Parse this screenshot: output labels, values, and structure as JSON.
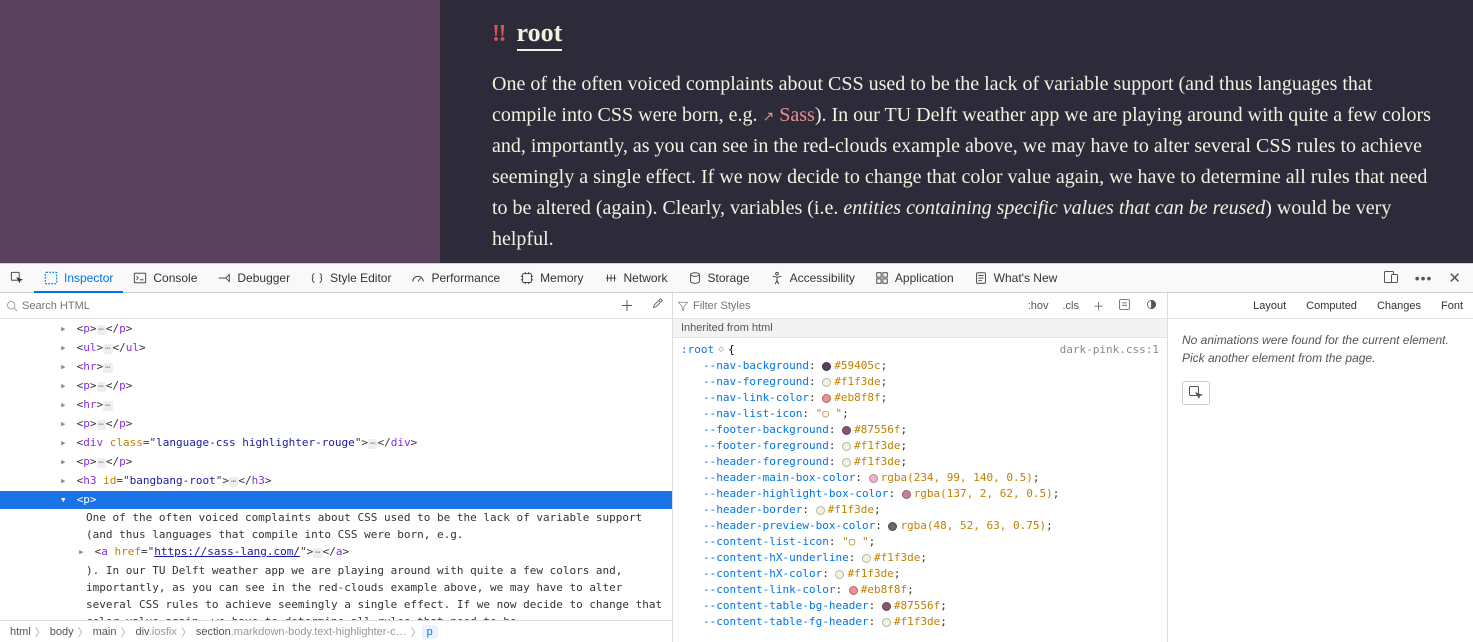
{
  "page": {
    "heading_icon": "‼",
    "heading_text": "root",
    "body_before_link": "One of the often voiced complaints about CSS used to be the lack of variable support (and thus languages that compile into CSS were born, e.g. ",
    "arrow": "↗",
    "link_text": "Sass",
    "body_mid": "). In our TU Delft weather app we are playing around with quite a few colors and, importantly, as you can see in the red-clouds example above, we may have to alter several CSS rules to achieve seemingly a single effect. If we now decide to change that color value again, we have to determine all rules that need to be altered (again). Clearly, variables (i.e. ",
    "body_italic": "entities containing specific values that can be reused",
    "body_after": ") would be very helpful."
  },
  "tabs": {
    "inspector": "Inspector",
    "console": "Console",
    "debugger": "Debugger",
    "styleeditor": "Style Editor",
    "performance": "Performance",
    "memory": "Memory",
    "network": "Network",
    "storage": "Storage",
    "accessibility": "Accessibility",
    "application": "Application",
    "whatsnew": "What's New"
  },
  "html_panel": {
    "search_placeholder": "Search HTML",
    "nodes": [
      "<p>…</p>",
      "<ul>…</ul>",
      "<hr>…",
      "<p>…</p>",
      "<hr>…",
      "<p>…</p>"
    ],
    "div_class": "language-css highlighter-rouge",
    "p_after_div": "<p>…</p>",
    "h3_id": "bangbang-root",
    "selected": "<p>",
    "text1": "One of the often voiced complaints about CSS used to be the lack of variable support (and thus languages that compile into CSS were born, e.g. ",
    "a_href": "https://sass-lang.com/",
    "text2": "). In our TU Delft weather app we are playing around with quite a few colors and, importantly, as you can see in the red-clouds example above, we may have to alter several CSS rules to achieve seemingly a single effect. If we now decide to change that color value again, we have to determine all rules that need to be "
  },
  "breadcrumb": {
    "items": [
      "html",
      "body",
      "main",
      "div.iosfix",
      "section.markdown-body.text-highlighter-c…",
      "p"
    ]
  },
  "styles": {
    "filter_placeholder": "Filter Styles",
    "hov": ":hov",
    "cls": ".cls",
    "inherited": "Inherited from html",
    "selector": ":root",
    "source": "dark-pink.css:1",
    "props": [
      {
        "name": "--nav-background",
        "color": "#59405c",
        "val": "#59405c"
      },
      {
        "name": "--nav-foreground",
        "color": "#f1f3de",
        "val": "#f1f3de"
      },
      {
        "name": "--nav-link-color",
        "color": "#eb8f8f",
        "val": "#eb8f8f"
      },
      {
        "name": "--nav-list-icon",
        "val": "\"○ \"",
        "noswatch": true
      },
      {
        "name": "--footer-background",
        "color": "#87556f",
        "val": "#87556f"
      },
      {
        "name": "--footer-foreground",
        "color": "#f1f3de",
        "val": "#f1f3de"
      },
      {
        "name": "--header-foreground",
        "color": "#f1f3de",
        "val": "#f1f3de"
      },
      {
        "name": "--header-main-box-color",
        "color": "rgba(234,99,140,0.5)",
        "val": "rgba(234, 99, 140, 0.5)"
      },
      {
        "name": "--header-highlight-box-color",
        "color": "rgba(137,2,62,0.5)",
        "val": "rgba(137, 2, 62, 0.5)"
      },
      {
        "name": "--header-border",
        "color": "#f1f3de",
        "val": "#f1f3de"
      },
      {
        "name": "--header-preview-box-color",
        "color": "rgba(48,52,63,0.75)",
        "val": "rgba(48, 52, 63, 0.75)"
      },
      {
        "name": "--content-list-icon",
        "val": "\"○ \"",
        "noswatch": true
      },
      {
        "name": "--content-hX-underline",
        "color": "#f1f3de",
        "val": "#f1f3de"
      },
      {
        "name": "--content-hX-color",
        "color": "#f1f3de",
        "val": "#f1f3de"
      },
      {
        "name": "--content-link-color",
        "color": "#eb8f8f",
        "val": "#eb8f8f"
      },
      {
        "name": "--content-table-bg-header",
        "color": "#87556f",
        "val": "#87556f"
      },
      {
        "name": "--content-table-fg-header",
        "color": "#f1f3de",
        "val": "#f1f3de"
      }
    ]
  },
  "side": {
    "tabs": [
      "Layout",
      "Computed",
      "Changes",
      "Font"
    ],
    "msg1": "No animations were found for the current element.",
    "msg2": "Pick another element from the page."
  }
}
